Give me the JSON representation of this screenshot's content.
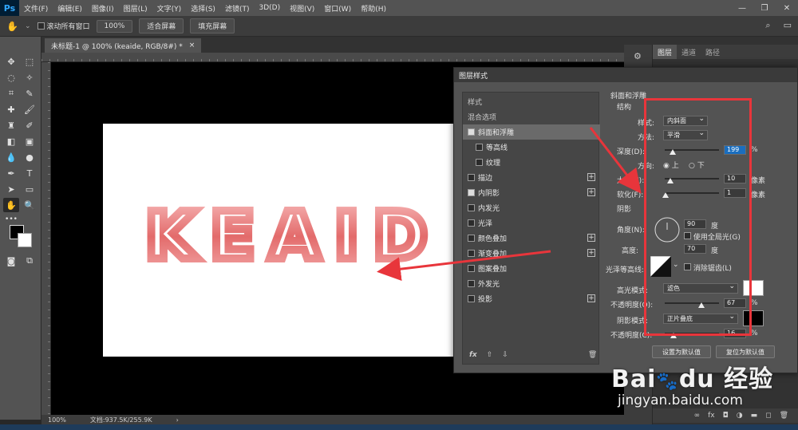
{
  "app": {
    "logo": "Ps"
  },
  "menu": [
    "文件(F)",
    "编辑(E)",
    "图像(I)",
    "图层(L)",
    "文字(Y)",
    "选择(S)",
    "滤镜(T)",
    "3D(D)",
    "视图(V)",
    "窗口(W)",
    "帮助(H)"
  ],
  "options": {
    "scroll_all": "滚动所有窗口",
    "zoom": "100%",
    "fit_screen": "适合屏幕",
    "fill_screen": "填充屏幕"
  },
  "document": {
    "tab_title": "未标题-1 @ 100% (keaide, RGB/8#) *",
    "close": "×",
    "canvas_text": "KEAID"
  },
  "status": {
    "zoom": "100%",
    "doc_size": "文档:937.5K/255.9K",
    "arrow": "›"
  },
  "panel": {
    "tabs": [
      "图层",
      "通道",
      "路径"
    ]
  },
  "dialog": {
    "title": "图层样式",
    "list": [
      {
        "label": "样式",
        "type": "header"
      },
      {
        "label": "混合选项",
        "type": "header"
      },
      {
        "label": "斜面和浮雕",
        "checked": true,
        "selected": true
      },
      {
        "label": "等高线",
        "checked": false,
        "indent": true
      },
      {
        "label": "纹理",
        "checked": false,
        "indent": true
      },
      {
        "label": "描边",
        "checked": false,
        "plus": true
      },
      {
        "label": "内阴影",
        "checked": true,
        "plus": true
      },
      {
        "label": "内发光",
        "checked": false
      },
      {
        "label": "光泽",
        "checked": false
      },
      {
        "label": "颜色叠加",
        "checked": false,
        "plus": true
      },
      {
        "label": "渐变叠加",
        "checked": false,
        "plus": true
      },
      {
        "label": "图案叠加",
        "checked": false
      },
      {
        "label": "外发光",
        "checked": false
      },
      {
        "label": "投影",
        "checked": false,
        "plus": true
      }
    ],
    "footer": {
      "fx": "fx",
      "up": "⇧",
      "down": "⇩",
      "trash": "🗑"
    },
    "bevel": {
      "section_title": "斜面和浮雕",
      "structure": "结构",
      "style_label": "样式:",
      "style_value": "内斜面",
      "technique_label": "方法:",
      "technique_value": "平滑",
      "depth_label": "深度(D):",
      "depth_value": "199",
      "depth_unit": "%",
      "direction_label": "方向:",
      "dir_up": "上",
      "dir_down": "下",
      "size_label": "大小(Z):",
      "size_value": "10",
      "size_unit": "像素",
      "soften_label": "软化(F):",
      "soften_value": "1",
      "soften_unit": "像素",
      "shading": "阴影",
      "angle_label": "角度(N):",
      "angle_value": "90",
      "angle_unit": "度",
      "global_light": "使用全局光(G)",
      "altitude_label": "高度:",
      "altitude_value": "70",
      "altitude_unit": "度",
      "gloss_label": "光泽等高线:",
      "antialias": "消除锯齿(L)",
      "highlight_label": "高光模式:",
      "highlight_value": "滤色",
      "highlight_opacity_label": "不透明度(O):",
      "highlight_opacity": "67",
      "pct": "%",
      "shadow_mode_label": "阴影模式:",
      "shadow_mode_value": "正片叠底",
      "shadow_opacity_label": "不透明度(C):",
      "shadow_opacity": "16",
      "make_default": "设置为默认值",
      "reset_default": "复位为默认值"
    },
    "depth_fraction": 0.15,
    "size_fraction": 0.1,
    "soften_fraction": 0.02,
    "highlight_opacity_fraction": 0.67,
    "shadow_opacity_fraction": 0.16
  },
  "watermark": {
    "brand": "Bai",
    "paw": "du",
    "cn": "经验",
    "url": "jingyan.baidu.com"
  },
  "colors": {
    "annotation_red": "#e8353b",
    "text_pink": "#e36b6b",
    "selection_blue": "#1a6ebf"
  }
}
